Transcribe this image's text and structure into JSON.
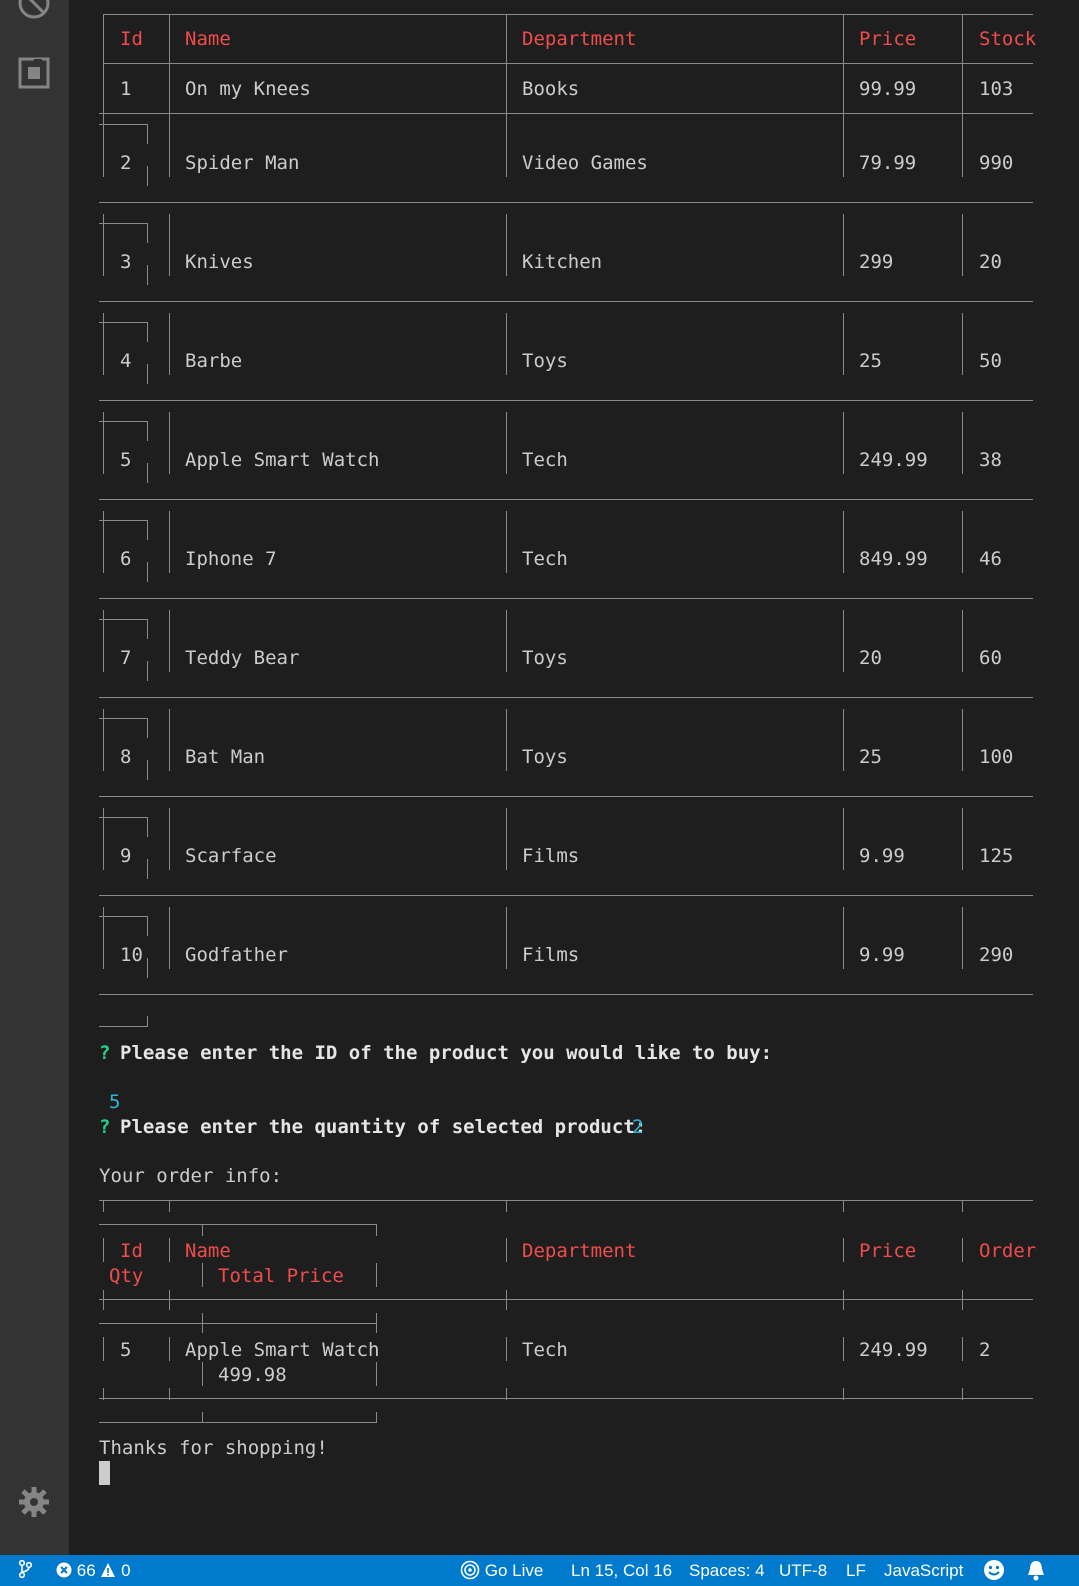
{
  "statusbar": {
    "errors": "66",
    "warnings": "0",
    "go_live": "Go Live",
    "position": "Ln 15, Col 16",
    "spaces": "Spaces: 4",
    "encoding": "UTF-8",
    "eol": "LF",
    "language": "JavaScript"
  },
  "products": {
    "headers": [
      "Id",
      "Name",
      "Department",
      "Price",
      "Stock"
    ],
    "rows": [
      [
        "1",
        "On my Knees",
        "Books",
        "99.99",
        "103"
      ],
      [
        "2",
        "Spider Man",
        "Video Games",
        "79.99",
        "990"
      ],
      [
        "3",
        "Knives",
        "Kitchen",
        "299",
        "20"
      ],
      [
        "4",
        "Barbe",
        "Toys",
        "25",
        "50"
      ],
      [
        "5",
        "Apple Smart Watch",
        "Tech",
        "249.99",
        "38"
      ],
      [
        "6",
        "Iphone 7",
        "Tech",
        "849.99",
        "46"
      ],
      [
        "7",
        "Teddy Bear",
        "Toys",
        "20",
        "60"
      ],
      [
        "8",
        "Bat Man",
        "Toys",
        "25",
        "100"
      ],
      [
        "9",
        "Scarface",
        "Films",
        "9.99",
        "125"
      ],
      [
        "10",
        "Godfather",
        "Films",
        "9.99",
        "290"
      ]
    ]
  },
  "prompts": {
    "mark": "?",
    "id_question": "Please enter the ID of the product you would like to buy:",
    "id_answer": "5",
    "qty_question": "Please enter the quantity of selected product:",
    "qty_answer": "2"
  },
  "order": {
    "intro": "Your order info:",
    "headers": [
      "Id",
      "Name",
      "Department",
      "Price",
      "Order",
      "Qty",
      "Total Price"
    ],
    "row": [
      "5",
      "Apple Smart Watch",
      "Tech",
      "249.99",
      "2",
      "499.98"
    ]
  },
  "outro": "Thanks for shopping!"
}
